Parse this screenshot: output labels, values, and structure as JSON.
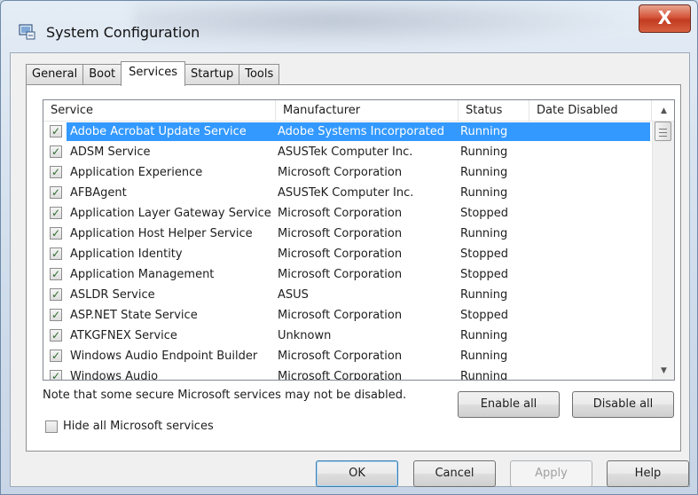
{
  "window": {
    "title": "System Configuration",
    "close_label": "X"
  },
  "tabs": [
    {
      "label": "General"
    },
    {
      "label": "Boot"
    },
    {
      "label": "Services"
    },
    {
      "label": "Startup"
    },
    {
      "label": "Tools"
    }
  ],
  "columns": {
    "service": "Service",
    "manufacturer": "Manufacturer",
    "status": "Status",
    "date_disabled": "Date Disabled"
  },
  "rows": [
    {
      "service": "Adobe Acrobat Update Service",
      "manufacturer": "Adobe Systems Incorporated",
      "status": "Running",
      "date_disabled": "",
      "checked": true,
      "selected": true
    },
    {
      "service": "ADSM Service",
      "manufacturer": "ASUSTek Computer Inc.",
      "status": "Running",
      "date_disabled": "",
      "checked": true
    },
    {
      "service": "Application Experience",
      "manufacturer": "Microsoft Corporation",
      "status": "Running",
      "date_disabled": "",
      "checked": true
    },
    {
      "service": "AFBAgent",
      "manufacturer": "ASUSTeK Computer Inc.",
      "status": "Running",
      "date_disabled": "",
      "checked": true
    },
    {
      "service": "Application Layer Gateway Service",
      "manufacturer": "Microsoft Corporation",
      "status": "Stopped",
      "date_disabled": "",
      "checked": true
    },
    {
      "service": "Application Host Helper Service",
      "manufacturer": "Microsoft Corporation",
      "status": "Running",
      "date_disabled": "",
      "checked": true
    },
    {
      "service": "Application Identity",
      "manufacturer": "Microsoft Corporation",
      "status": "Stopped",
      "date_disabled": "",
      "checked": true
    },
    {
      "service": "Application Management",
      "manufacturer": "Microsoft Corporation",
      "status": "Stopped",
      "date_disabled": "",
      "checked": true
    },
    {
      "service": "ASLDR Service",
      "manufacturer": "ASUS",
      "status": "Running",
      "date_disabled": "",
      "checked": true
    },
    {
      "service": "ASP.NET State Service",
      "manufacturer": "Microsoft Corporation",
      "status": "Stopped",
      "date_disabled": "",
      "checked": true
    },
    {
      "service": "ATKGFNEX Service",
      "manufacturer": "Unknown",
      "status": "Running",
      "date_disabled": "",
      "checked": true
    },
    {
      "service": "Windows Audio Endpoint Builder",
      "manufacturer": "Microsoft Corporation",
      "status": "Running",
      "date_disabled": "",
      "checked": true
    },
    {
      "service": "Windows Audio",
      "manufacturer": "Microsoft Corporation",
      "status": "Running",
      "date_disabled": "",
      "checked": true
    }
  ],
  "note": "Note that some secure Microsoft services may not be disabled.",
  "hide_ms_label": "Hide all Microsoft services",
  "buttons": {
    "enable_all": "Enable all",
    "disable_all": "Disable all",
    "ok": "OK",
    "cancel": "Cancel",
    "apply": "Apply",
    "help": "Help"
  },
  "colors": {
    "selection": "#3399ff",
    "close_button": "#c8442a"
  },
  "icons": {
    "window": "system-config-icon",
    "check": "checkmark-icon"
  }
}
